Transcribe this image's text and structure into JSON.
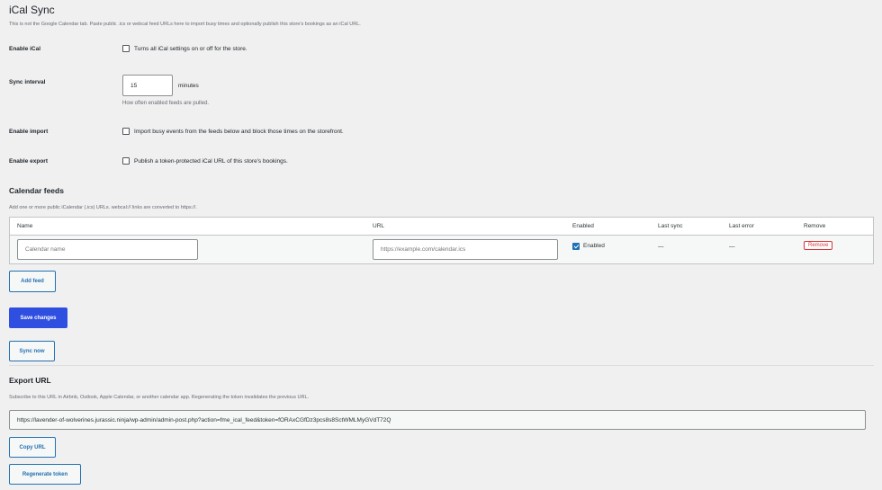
{
  "page": {
    "title": "iCal Sync",
    "description": "This is not the Google Calendar tab. Paste public .ics or webcal feed URLs here to import busy times and optionally publish this store's bookings as an iCal URL."
  },
  "settings": {
    "enable_ical": {
      "label": "Enable iCal",
      "text": "Turns all iCal settings on or off for the store.",
      "checked": false
    },
    "sync_interval": {
      "label": "Sync interval",
      "value": "15",
      "unit": "minutes",
      "help": "How often enabled feeds are pulled."
    },
    "enable_import": {
      "label": "Enable import",
      "text": "Import busy events from the feeds below and block those times on the storefront.",
      "checked": false
    },
    "enable_export": {
      "label": "Enable export",
      "text": "Publish a token-protected iCal URL of this store's bookings.",
      "checked": false
    }
  },
  "feeds": {
    "heading": "Calendar feeds",
    "description": "Add one or more public iCalendar (.ics) URLs. webcal:// links are converted to https://.",
    "columns": [
      "Name",
      "URL",
      "Enabled",
      "Last sync",
      "Last error",
      "Remove"
    ],
    "rows": [
      {
        "name_placeholder": "Calendar name",
        "url_placeholder": "https://example.com/calendar.ics",
        "enabled": true,
        "enabled_label": "Enabled",
        "last_sync": "—",
        "last_error": "—",
        "remove_label": "Remove"
      }
    ],
    "add_label": "Add feed"
  },
  "actions": {
    "save_label": "Save changes",
    "sync_label": "Sync now"
  },
  "export": {
    "heading": "Export URL",
    "description": "Subscribe to this URL in Airbnb, Outlook, Apple Calendar, or another calendar app. Regenerating the token invalidates the previous URL.",
    "url": "https://lavender-of-wolverines.jurassic.ninja/wp-admin/admin-post.php?action=fme_ical_feed&token=fORAxCGfDz3pcs8s8SctWMLMyGVdT72Q",
    "copy_label": "Copy URL",
    "regenerate_label": "Regenerate token"
  },
  "colors": {
    "accent": "#2271b1",
    "primary_button": "#2f4fe0",
    "danger": "#d63638",
    "background": "#f0f0f1"
  }
}
